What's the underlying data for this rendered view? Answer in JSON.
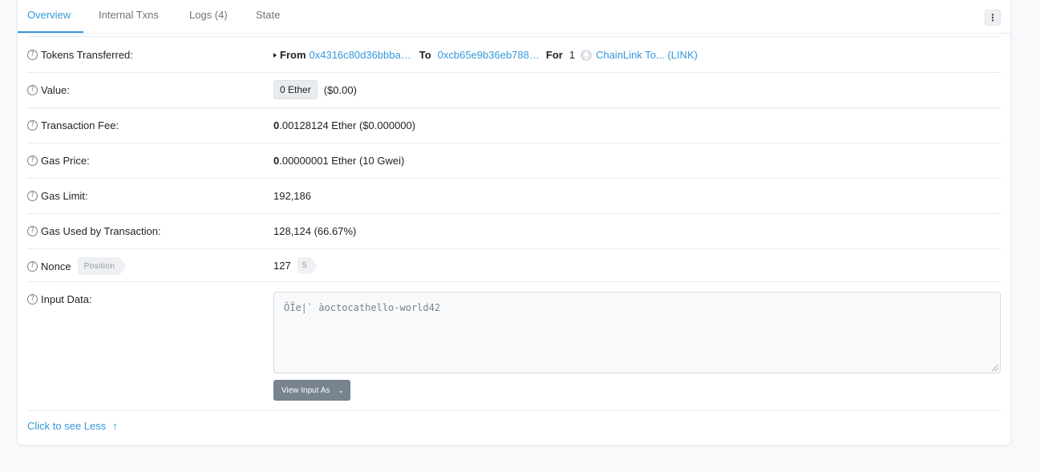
{
  "tabs": {
    "overview": "Overview",
    "internal_txns": "Internal Txns",
    "logs": "Logs (4)",
    "state": "State"
  },
  "more_icon": "more-vertical-icon",
  "rows": {
    "tokens": {
      "label": "Tokens Transferred:",
      "from_label": "From",
      "from_addr": "0x4316c80d36bbba…",
      "to_label": "To",
      "to_addr": "0xcb65e9b36eb788…",
      "for_label": "For",
      "amount": "1",
      "token_name": "ChainLink To... (LINK)"
    },
    "value": {
      "label": "Value:",
      "badge": "0 Ether",
      "usd": "($0.00)"
    },
    "fee": {
      "label": "Transaction Fee:",
      "int": "0",
      "rest": ".00128124 Ether ($0.000000)"
    },
    "gas_price": {
      "label": "Gas Price:",
      "int": "0",
      "rest": ".00000001 Ether (10 Gwei)"
    },
    "gas_limit": {
      "label": "Gas Limit:",
      "value": "192,186"
    },
    "gas_used": {
      "label": "Gas Used by Transaction:",
      "value": "128,124 (66.67%)"
    },
    "nonce": {
      "label": "Nonce",
      "tag": "Position",
      "value": "127",
      "position": "5"
    },
    "input": {
      "label": "Input Data:",
      "content": "ÕÏe|` à\u0001octocat\u0001hello-world\u000142",
      "view_btn": "View Input As"
    }
  },
  "see_less": "Click to see Less",
  "colors": {
    "link": "#3498db",
    "text": "#1e2022",
    "muted": "#77838f",
    "border": "#e7eaf3"
  }
}
